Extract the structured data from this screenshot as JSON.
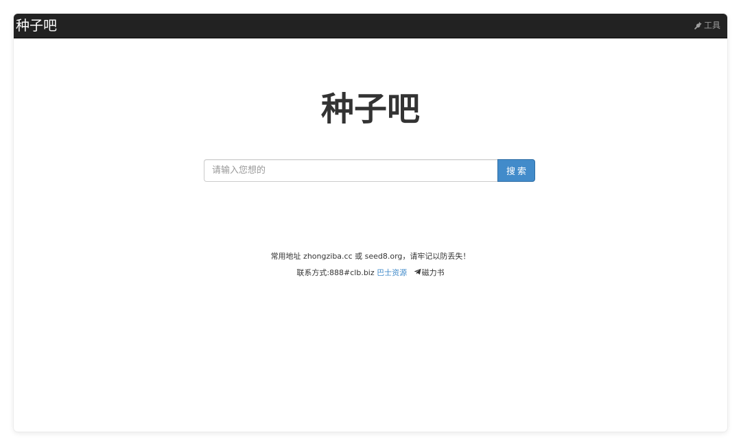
{
  "navbar": {
    "brand": "种子吧",
    "tools_label": "工具",
    "tools_icon": "wrench-icon"
  },
  "main": {
    "title": "种子吧",
    "search": {
      "placeholder": "请输入您想的",
      "value": "",
      "button_label": "搜索"
    }
  },
  "footer": {
    "line1": "常用地址 zhongziba.cc 或 seed8.org，请牢记以防丢失！",
    "contact_text": "联系方式:888#clb.biz",
    "link_label": "巴士资源",
    "telegram_icon": "telegram-icon",
    "telegram_label": "磁力书"
  },
  "colors": {
    "navbar_bg": "#222222",
    "button_bg": "#428bca",
    "link": "#428bca"
  }
}
